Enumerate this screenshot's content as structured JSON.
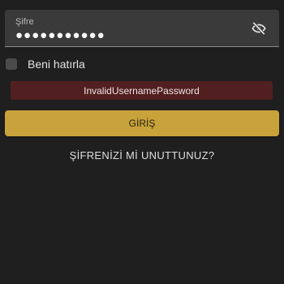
{
  "password_field": {
    "label": "Şifre",
    "value": "●●●●●●●●●●●",
    "toggle_icon": "eye-off-icon"
  },
  "remember_me": {
    "label": "Beni hatırla",
    "checked": false
  },
  "error": {
    "message": "InvalidUsernamePassword"
  },
  "login_button": {
    "label": "GİRİŞ"
  },
  "forgot_password": {
    "label": "ŞİFRENİZİ Mİ UNUTTUNUZ?"
  },
  "colors": {
    "background": "#1f1f1f",
    "field_bg": "#3a3a3a",
    "error_bg": "#511f1f",
    "accent": "#c8a23a"
  }
}
